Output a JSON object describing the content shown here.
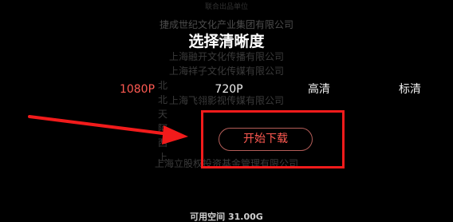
{
  "credits": {
    "heading": "联合出品单位",
    "lines": [
      "捷成世纪文化产业集团有限公司",
      "国",
      "上海融开文化传播有限公司",
      "上海祥子文化传媒有限公司",
      "北",
      "北",
      "上海飞翎影视传媒有限公司",
      "天",
      "阿",
      "西",
      "上",
      "上海立股权投资基金管理有限公司"
    ]
  },
  "dialog": {
    "title": "选择清晰度",
    "options": [
      {
        "label": "1080P",
        "selected": true
      },
      {
        "label": "720P",
        "selected": false
      },
      {
        "label": "高清",
        "selected": false
      },
      {
        "label": "标清",
        "selected": false
      }
    ],
    "download_label": "开始下载",
    "footer_text": "可用空间 31.00G"
  },
  "annotation": {
    "box_color": "#f21b1b",
    "arrow_color": "#f21b1b"
  },
  "colors": {
    "selected": "#ff5a52",
    "background": "#000000"
  }
}
